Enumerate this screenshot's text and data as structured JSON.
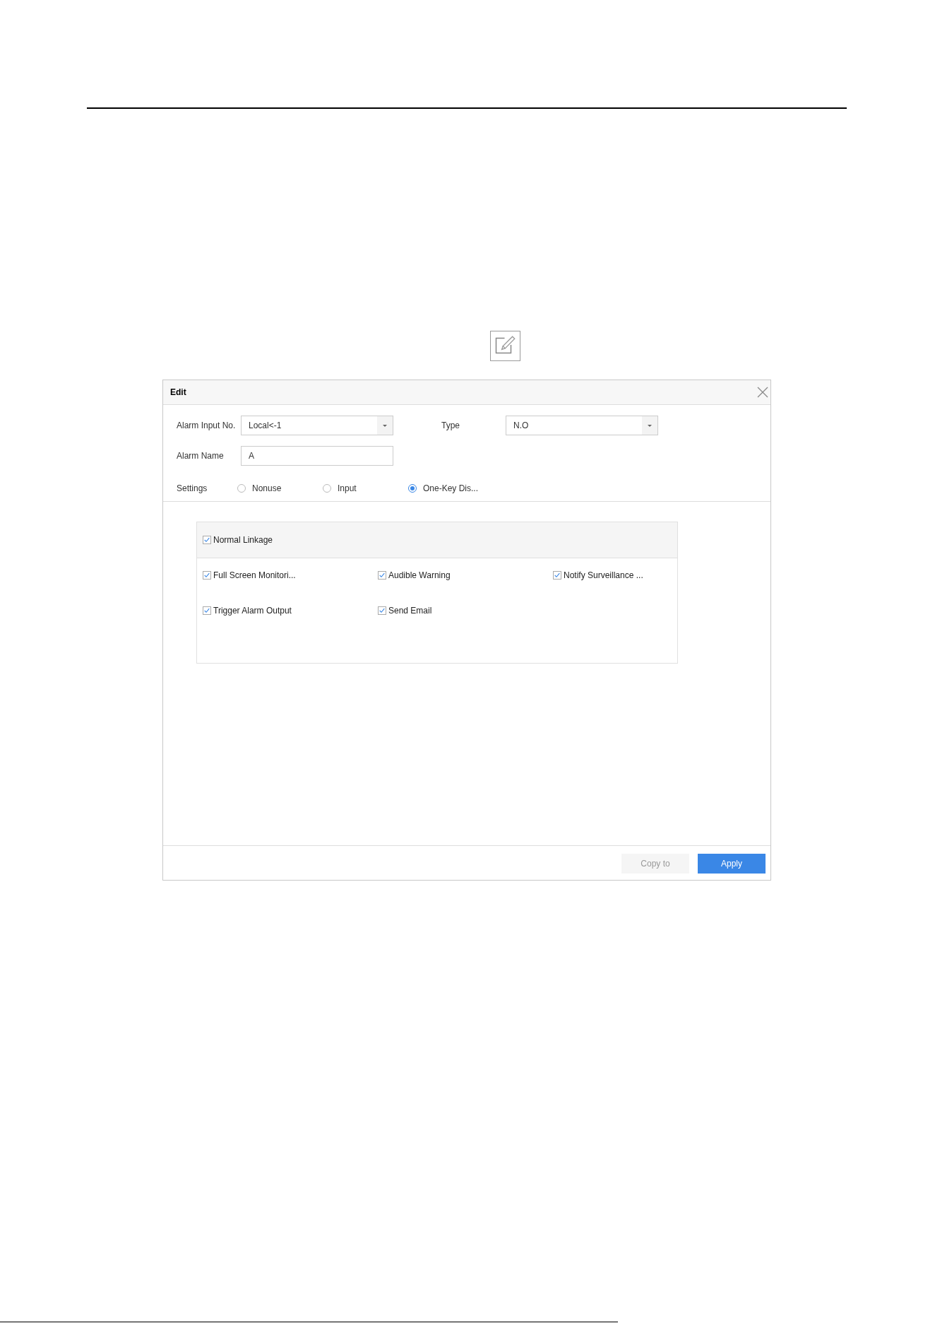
{
  "dialog": {
    "title": "Edit",
    "rows": [
      {
        "fields": [
          {
            "kind": "select",
            "label": "Alarm Input No.",
            "value": "Local<-1"
          },
          {
            "kind": "select",
            "label": "Type",
            "value": "N.O"
          }
        ]
      },
      {
        "fields": [
          {
            "kind": "text",
            "label": "Alarm Name",
            "value": "A"
          }
        ]
      }
    ],
    "settings": {
      "label": "Settings",
      "options": [
        {
          "label": "Nonuse",
          "selected": false
        },
        {
          "label": "Input",
          "selected": false
        },
        {
          "label": "One-Key Dis...",
          "selected": true
        }
      ]
    },
    "linkage": {
      "header": {
        "label": "Normal Linkage",
        "checked": true
      },
      "items": [
        {
          "label": "Full Screen Monitori...",
          "checked": true
        },
        {
          "label": "Audible Warning",
          "checked": true
        },
        {
          "label": "Notify Surveillance ...",
          "checked": true
        },
        {
          "label": "Trigger Alarm Output",
          "checked": true
        },
        {
          "label": "Send Email",
          "checked": true
        }
      ]
    },
    "buttons": [
      {
        "label": "Copy to",
        "kind": "secondary"
      },
      {
        "label": "Apply",
        "kind": "primary"
      }
    ]
  }
}
